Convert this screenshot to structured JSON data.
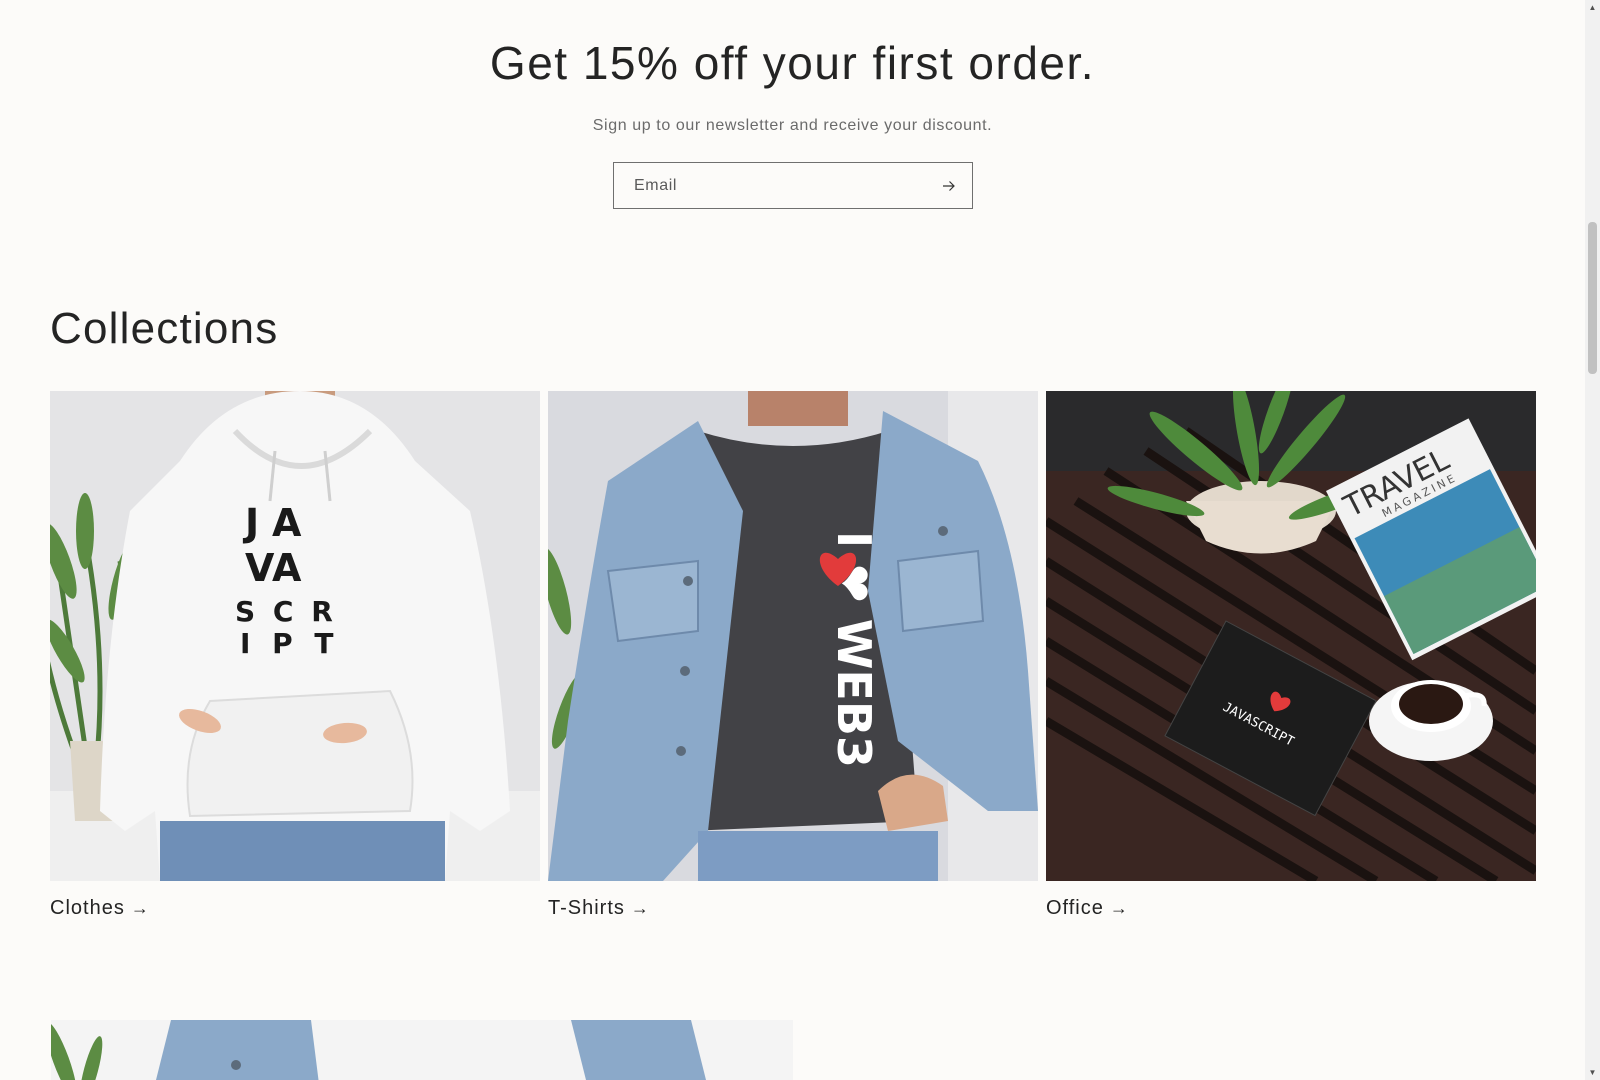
{
  "newsletter": {
    "title": "Get 15% off your first order.",
    "subtitle": "Sign up to our newsletter and receive your discount.",
    "email_placeholder": "Email",
    "submit_icon": "arrow-right-icon"
  },
  "collections": {
    "heading": "Collections",
    "items": [
      {
        "label": "Clothes",
        "icon": "arrow-right-icon"
      },
      {
        "label": "T-Shirts",
        "icon": "arrow-right-icon"
      },
      {
        "label": "Office",
        "icon": "arrow-right-icon"
      }
    ]
  },
  "product_prints": {
    "hoodie": [
      "J",
      "A",
      "V",
      "A",
      "S C R",
      "I P T"
    ],
    "tshirt": "I ❤ WEB3",
    "notebook": "JAVASCRIPT",
    "magazine": "TRAVEL",
    "magazine_sub": "MAGAZINE"
  },
  "colors": {
    "background": "#fcfbf9",
    "text": "#242424",
    "heart": "#e23b3b"
  }
}
